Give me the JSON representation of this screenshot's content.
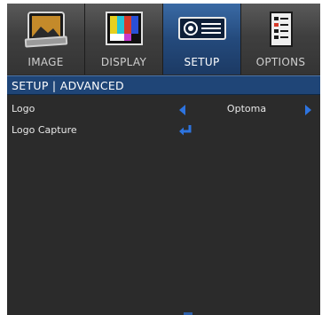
{
  "tabs": [
    {
      "label": "IMAGE",
      "icon": "image-picture-icon",
      "active": false
    },
    {
      "label": "DISPLAY",
      "icon": "display-color-bars-icon",
      "active": false
    },
    {
      "label": "SETUP",
      "icon": "projector-icon",
      "active": true
    },
    {
      "label": "OPTIONS",
      "icon": "options-list-icon",
      "active": false
    }
  ],
  "title": "SETUP | ADVANCED",
  "rows": [
    {
      "label": "Logo",
      "value": "Optoma"
    },
    {
      "label": "Logo Capture"
    }
  ],
  "colors": {
    "accent": "#2d74e0",
    "titlebar": "#1f4577",
    "background": "#2b2b2b"
  }
}
